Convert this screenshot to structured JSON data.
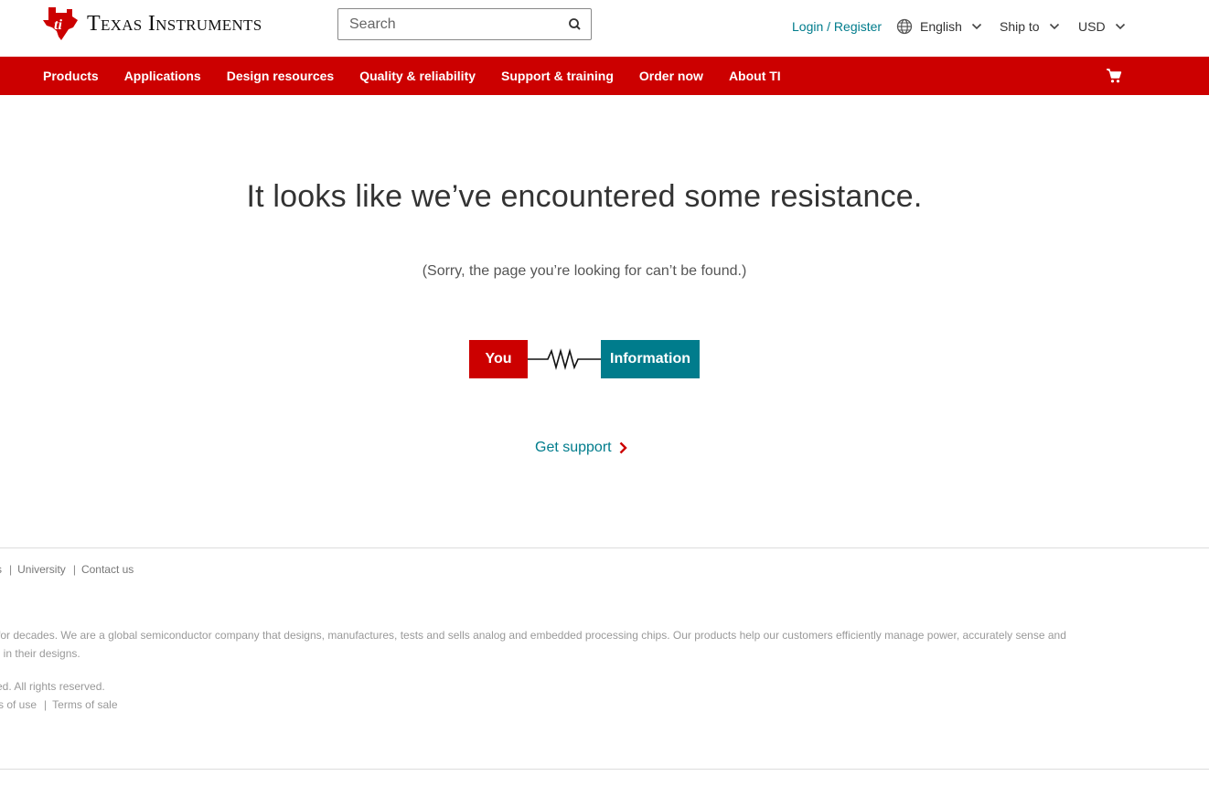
{
  "header": {
    "logo_text": "Texas Instruments",
    "search_placeholder": "Search",
    "login": "Login / Register",
    "language": "English",
    "ship_to": "Ship to",
    "currency": "USD"
  },
  "nav": {
    "items": [
      "Products",
      "Applications",
      "Design resources",
      "Quality & reliability",
      "Support & training",
      "Order now",
      "About TI"
    ]
  },
  "main": {
    "headline": "It looks like we’ve encountered some resistance.",
    "subline": "(Sorry, the page you’re looking for can’t be found.)",
    "diagram": {
      "left_label": "You",
      "right_label": "Information"
    },
    "support_link": "Get support"
  },
  "footer": {
    "links": [
      "rs",
      "University",
      "Contact us"
    ],
    "description_line1": "e for decades. We are a global semiconductor company that designs, manufactures, tests and sells analog and embedded processing chips. Our products help our customers efficiently manage power, accurately sense and",
    "description_line2": "ng in their designs.",
    "copyright": "ved. All rights reserved.",
    "terms": [
      "ms of use",
      "Terms of sale"
    ]
  },
  "colors": {
    "brand_red": "#cc0000",
    "accent_teal": "#007c8c"
  },
  "icons": [
    "ti-logo-icon",
    "search-icon",
    "globe-icon",
    "chevron-down-icon",
    "cart-icon",
    "chevron-right-icon",
    "resistor-icon"
  ]
}
